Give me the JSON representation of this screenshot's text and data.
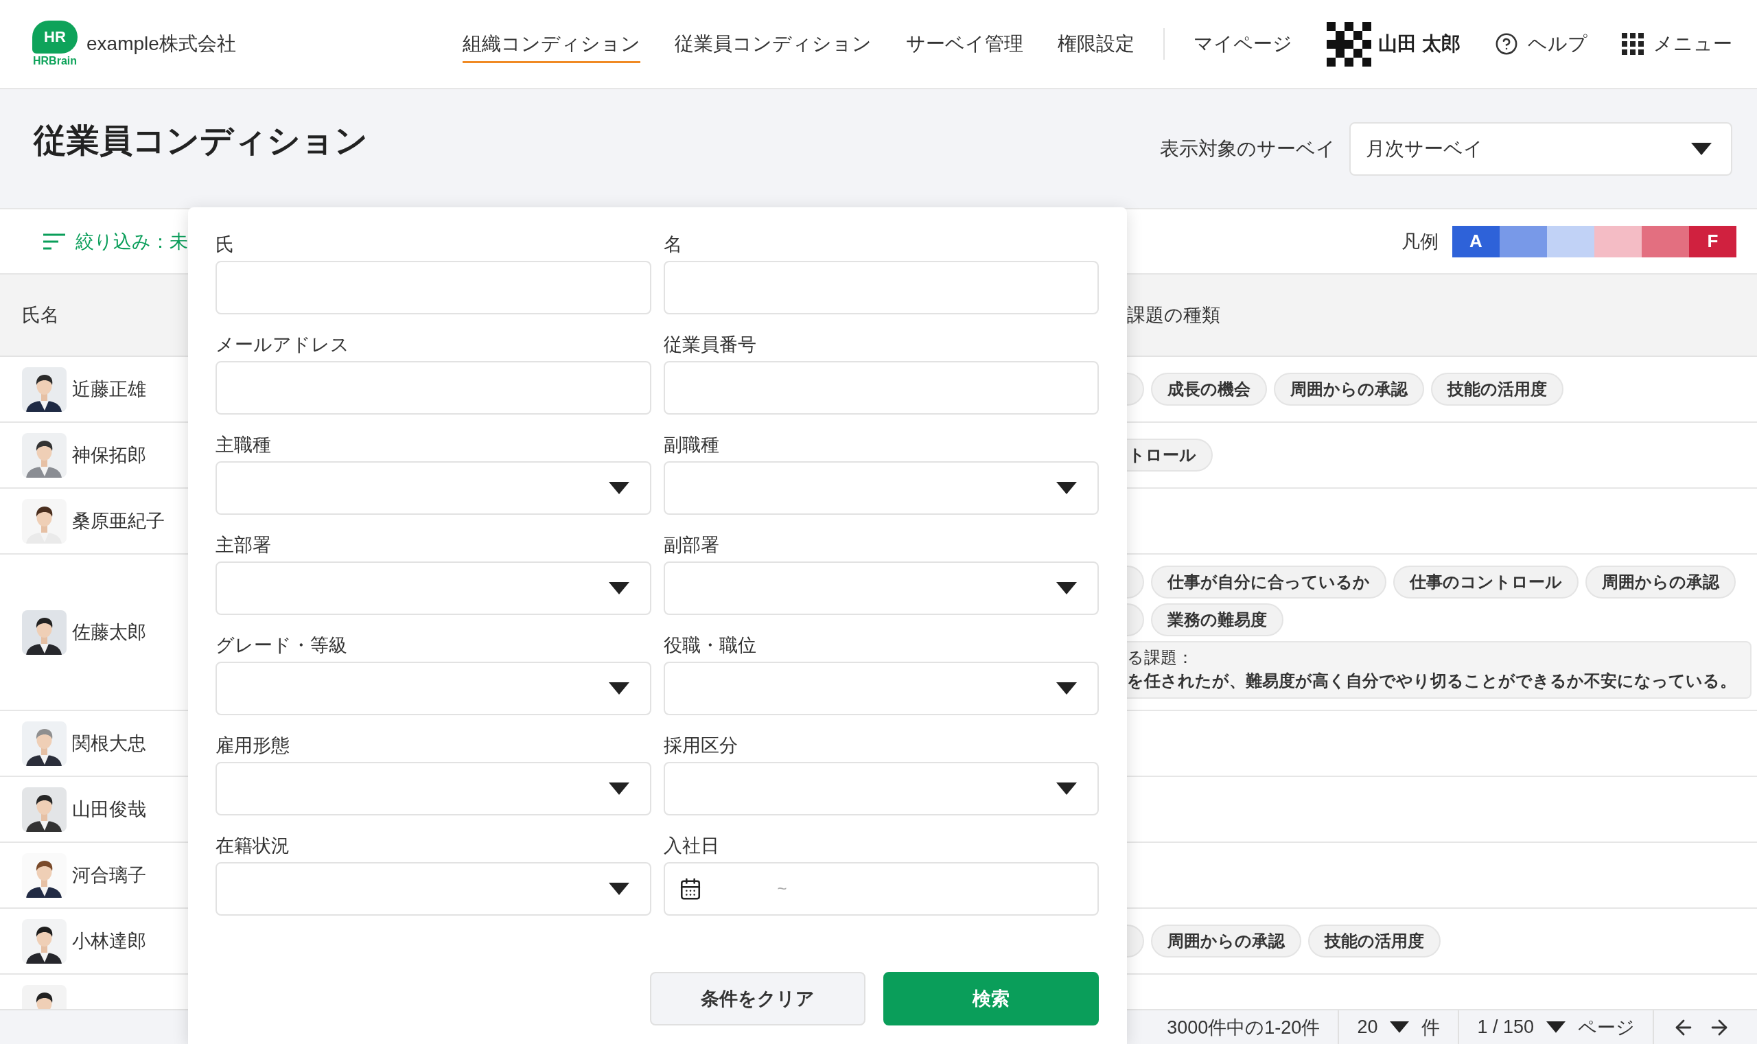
{
  "header": {
    "logo": {
      "mark": "HR",
      "wordmark": "HRBrain"
    },
    "company": "example株式会社",
    "nav": [
      {
        "label": "組織コンディション",
        "selected": true
      },
      {
        "label": "従業員コンディション",
        "selected": false
      },
      {
        "label": "サーベイ管理",
        "selected": false
      },
      {
        "label": "権限設定",
        "selected": false
      }
    ],
    "mypage": "マイページ",
    "user": "山田 太郎",
    "help": "ヘルプ",
    "menu": "メニュー"
  },
  "page": {
    "title": "従業員コンディション",
    "survey_label": "表示対象のサーベイ",
    "survey_value": "月次サーベイ"
  },
  "filter": {
    "label": "絞り込み：未"
  },
  "legend": {
    "label": "凡例",
    "items": [
      {
        "color": "#2e62d9",
        "label": "A"
      },
      {
        "color": "#7899e8"
      },
      {
        "color": "#c1d2f6"
      },
      {
        "color": "#f4bcc5"
      },
      {
        "color": "#e36f80"
      },
      {
        "color": "#d0213f",
        "label": "F"
      }
    ]
  },
  "table": {
    "columns": [
      "氏名",
      "課題の種類"
    ],
    "rows": [
      {
        "name": "近藤正雄",
        "tag_lines": [
          [
            {
              "kind": "edge"
            },
            {
              "kind": "full",
              "text": "成長の機会"
            },
            {
              "kind": "full",
              "text": "周囲からの承認"
            },
            {
              "kind": "full",
              "text": "技能の活用度"
            }
          ]
        ]
      },
      {
        "name": "神保拓郎",
        "tag_lines": [
          [
            {
              "kind": "cut",
              "text": "トロール"
            }
          ]
        ]
      },
      {
        "name": "桑原亜紀子"
      },
      {
        "name": "佐藤太郎",
        "tag_lines": [
          [
            {
              "kind": "edge"
            },
            {
              "kind": "full",
              "text": "仕事が自分に合っているか"
            },
            {
              "kind": "full",
              "text": "仕事のコントロール"
            },
            {
              "kind": "full",
              "text": "周囲からの承認"
            }
          ],
          [
            {
              "kind": "edge"
            },
            {
              "kind": "full",
              "text": "業務の難易度"
            }
          ]
        ],
        "note": [
          "る課題：",
          "を任されたが、難易度が高く自分でやり切ることができるか不安になっている。"
        ]
      },
      {
        "name": "関根大忠"
      },
      {
        "name": "山田俊哉"
      },
      {
        "name": "河合璃子"
      },
      {
        "name": "小林達郎",
        "tag_lines": [
          [
            {
              "kind": "edge"
            },
            {
              "kind": "full",
              "text": "周囲からの承認"
            },
            {
              "kind": "full",
              "text": "技能の活用度"
            }
          ]
        ]
      },
      {}
    ]
  },
  "filter_dialog": {
    "fields": [
      {
        "label": "氏",
        "kind": "text"
      },
      {
        "label": "名",
        "kind": "text"
      },
      {
        "label": "メールアドレス",
        "kind": "text"
      },
      {
        "label": "従業員番号",
        "kind": "text"
      },
      {
        "label": "主職種",
        "kind": "select"
      },
      {
        "label": "副職種",
        "kind": "select"
      },
      {
        "label": "主部署",
        "kind": "select"
      },
      {
        "label": "副部署",
        "kind": "select"
      },
      {
        "label": "グレード・等級",
        "kind": "select"
      },
      {
        "label": "役職・職位",
        "kind": "select"
      },
      {
        "label": "雇用形態",
        "kind": "select"
      },
      {
        "label": "採用区分",
        "kind": "select"
      },
      {
        "label": "在籍状況",
        "kind": "select"
      },
      {
        "label": "入社日",
        "kind": "date",
        "separator": "~"
      }
    ],
    "buttons": [
      {
        "label": "条件をクリア",
        "kind": "secondary"
      },
      {
        "label": "検索",
        "kind": "primary"
      }
    ]
  },
  "pagination": {
    "summary": "3000件中の1-20件",
    "per_page": "20",
    "per_page_unit": "件",
    "page": "1 / 150",
    "page_unit": "ページ"
  }
}
